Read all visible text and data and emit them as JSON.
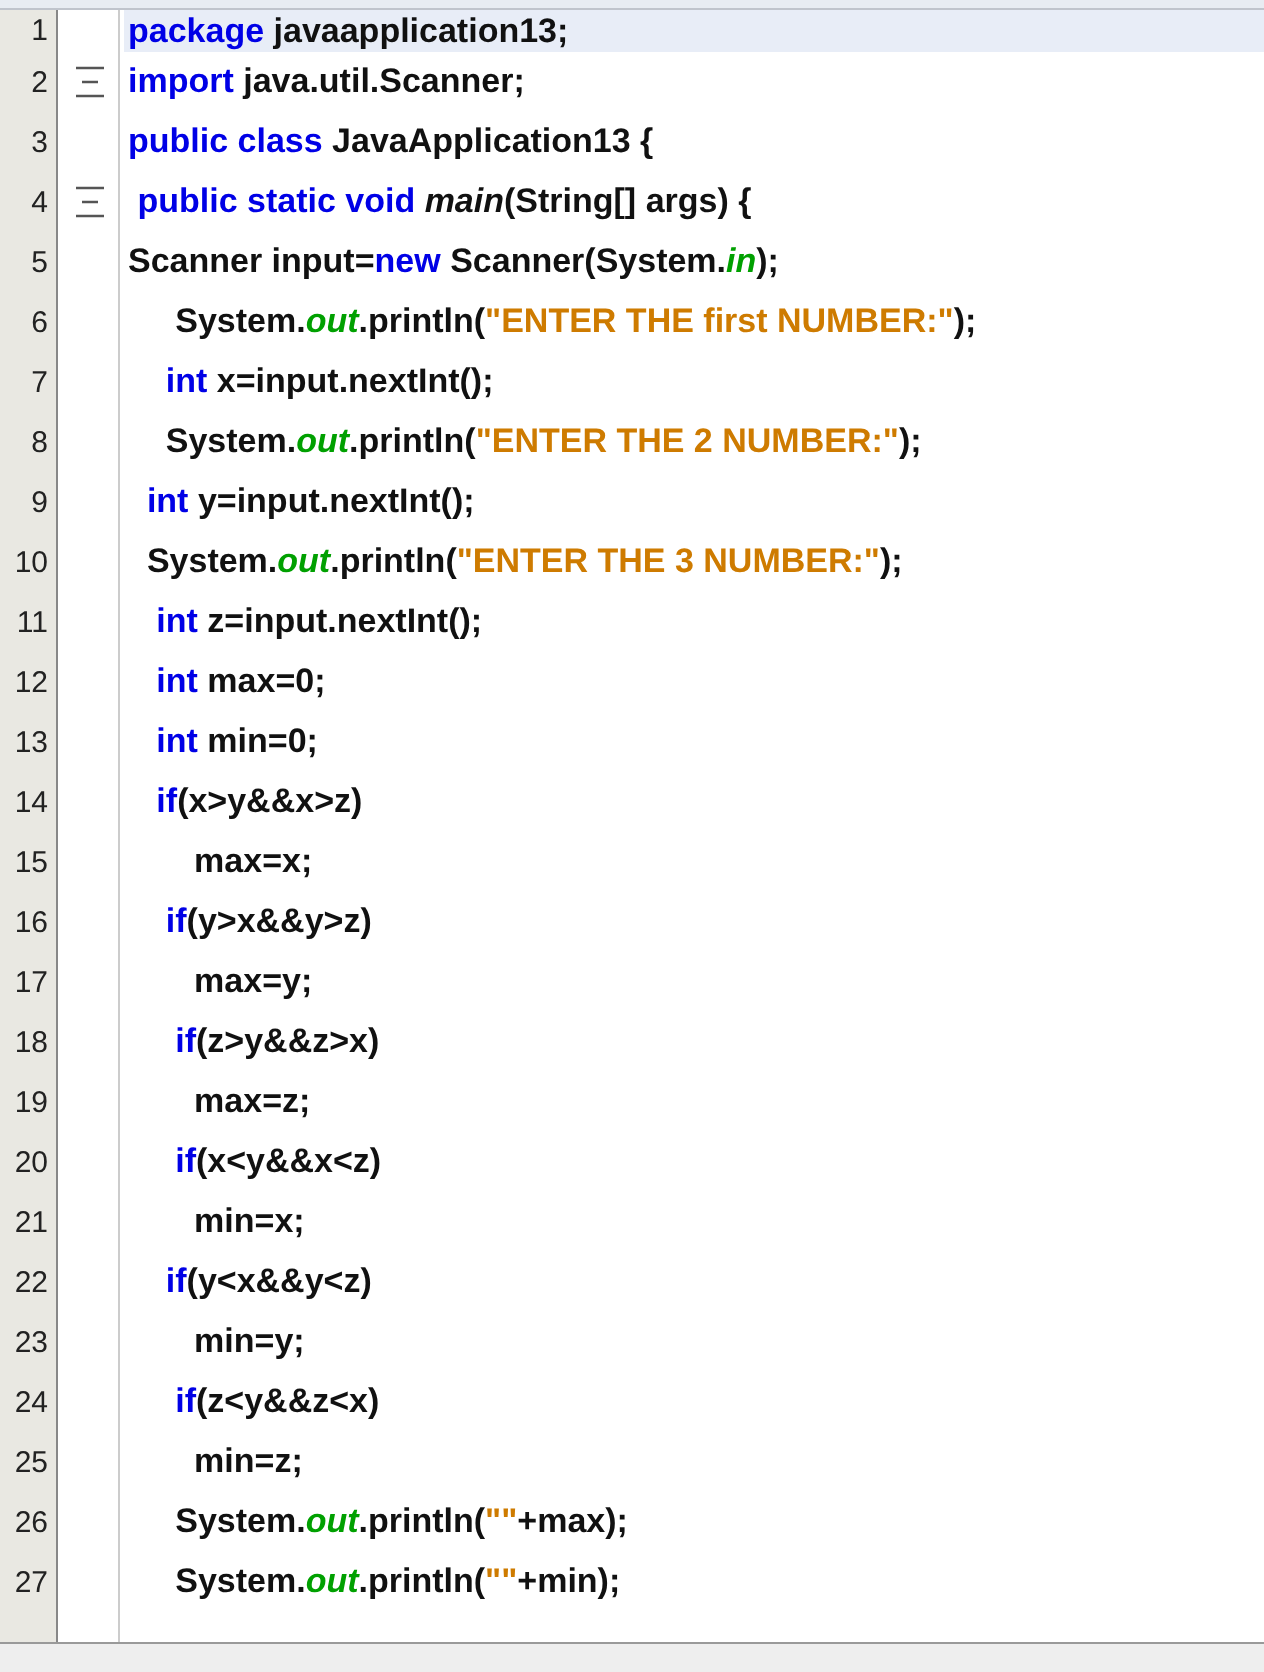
{
  "editor": {
    "lines": [
      {
        "number": "1",
        "current": true,
        "fold": false,
        "tokens": [
          {
            "kind": "kw",
            "text": "package"
          },
          {
            "kind": "txt",
            "text": " javaapplication13;"
          }
        ]
      },
      {
        "number": "2",
        "current": false,
        "fold": true,
        "tokens": [
          {
            "kind": "kw",
            "text": "import"
          },
          {
            "kind": "txt",
            "text": " java.util.Scanner;"
          }
        ]
      },
      {
        "number": "3",
        "current": false,
        "fold": false,
        "tokens": [
          {
            "kind": "kw",
            "text": "public class"
          },
          {
            "kind": "txt",
            "text": " JavaApplication13 {"
          }
        ]
      },
      {
        "number": "4",
        "current": false,
        "fold": true,
        "tokens": [
          {
            "kind": "kw",
            "text": " public static void "
          },
          {
            "kind": "method",
            "text": "main"
          },
          {
            "kind": "txt",
            "text": "(String[] args) {"
          }
        ]
      },
      {
        "number": "5",
        "current": false,
        "fold": false,
        "tokens": [
          {
            "kind": "txt",
            "text": "Scanner input="
          },
          {
            "kind": "kw",
            "text": "new"
          },
          {
            "kind": "txt",
            "text": " Scanner(System."
          },
          {
            "kind": "field",
            "text": "in"
          },
          {
            "kind": "txt",
            "text": ");"
          }
        ]
      },
      {
        "number": "6",
        "current": false,
        "fold": false,
        "tokens": [
          {
            "kind": "txt",
            "text": "     System."
          },
          {
            "kind": "field",
            "text": "out"
          },
          {
            "kind": "txt",
            "text": ".println("
          },
          {
            "kind": "str",
            "text": "\"ENTER THE first NUMBER:\""
          },
          {
            "kind": "txt",
            "text": ");"
          }
        ]
      },
      {
        "number": "7",
        "current": false,
        "fold": false,
        "tokens": [
          {
            "kind": "kw",
            "text": "    int"
          },
          {
            "kind": "txt",
            "text": " x=input.nextInt();"
          }
        ]
      },
      {
        "number": "8",
        "current": false,
        "fold": false,
        "tokens": [
          {
            "kind": "txt",
            "text": "    System."
          },
          {
            "kind": "field",
            "text": "out"
          },
          {
            "kind": "txt",
            "text": ".println("
          },
          {
            "kind": "str",
            "text": "\"ENTER THE 2 NUMBER:\""
          },
          {
            "kind": "txt",
            "text": ");"
          }
        ]
      },
      {
        "number": "9",
        "current": false,
        "fold": false,
        "tokens": [
          {
            "kind": "kw",
            "text": "  int"
          },
          {
            "kind": "txt",
            "text": " y=input.nextInt();"
          }
        ]
      },
      {
        "number": "10",
        "current": false,
        "fold": false,
        "tokens": [
          {
            "kind": "txt",
            "text": "  System."
          },
          {
            "kind": "field",
            "text": "out"
          },
          {
            "kind": "txt",
            "text": ".println("
          },
          {
            "kind": "str",
            "text": "\"ENTER THE 3 NUMBER:\""
          },
          {
            "kind": "txt",
            "text": ");"
          }
        ]
      },
      {
        "number": "11",
        "current": false,
        "fold": false,
        "tokens": [
          {
            "kind": "kw",
            "text": "   int"
          },
          {
            "kind": "txt",
            "text": " z=input.nextInt();"
          }
        ]
      },
      {
        "number": "12",
        "current": false,
        "fold": false,
        "tokens": [
          {
            "kind": "kw",
            "text": "   int"
          },
          {
            "kind": "txt",
            "text": " max=0;"
          }
        ]
      },
      {
        "number": "13",
        "current": false,
        "fold": false,
        "tokens": [
          {
            "kind": "kw",
            "text": "   int"
          },
          {
            "kind": "txt",
            "text": " min=0;"
          }
        ]
      },
      {
        "number": "14",
        "current": false,
        "fold": false,
        "tokens": [
          {
            "kind": "kw",
            "text": "   if"
          },
          {
            "kind": "txt",
            "text": "(x>y&&x>z)"
          }
        ]
      },
      {
        "number": "15",
        "current": false,
        "fold": false,
        "tokens": [
          {
            "kind": "txt",
            "text": "       max=x;"
          }
        ]
      },
      {
        "number": "16",
        "current": false,
        "fold": false,
        "tokens": [
          {
            "kind": "kw",
            "text": "    if"
          },
          {
            "kind": "txt",
            "text": "(y>x&&y>z)"
          }
        ]
      },
      {
        "number": "17",
        "current": false,
        "fold": false,
        "tokens": [
          {
            "kind": "txt",
            "text": "       max=y;"
          }
        ]
      },
      {
        "number": "18",
        "current": false,
        "fold": false,
        "tokens": [
          {
            "kind": "kw",
            "text": "     if"
          },
          {
            "kind": "txt",
            "text": "(z>y&&z>x)"
          }
        ]
      },
      {
        "number": "19",
        "current": false,
        "fold": false,
        "tokens": [
          {
            "kind": "txt",
            "text": "       max=z;"
          }
        ]
      },
      {
        "number": "20",
        "current": false,
        "fold": false,
        "tokens": [
          {
            "kind": "kw",
            "text": "     if"
          },
          {
            "kind": "txt",
            "text": "(x<y&&x<z)"
          }
        ]
      },
      {
        "number": "21",
        "current": false,
        "fold": false,
        "tokens": [
          {
            "kind": "txt",
            "text": "       min=x;"
          }
        ]
      },
      {
        "number": "22",
        "current": false,
        "fold": false,
        "tokens": [
          {
            "kind": "kw",
            "text": "    if"
          },
          {
            "kind": "txt",
            "text": "(y<x&&y<z)"
          }
        ]
      },
      {
        "number": "23",
        "current": false,
        "fold": false,
        "tokens": [
          {
            "kind": "txt",
            "text": "       min=y;"
          }
        ]
      },
      {
        "number": "24",
        "current": false,
        "fold": false,
        "tokens": [
          {
            "kind": "kw",
            "text": "     if"
          },
          {
            "kind": "txt",
            "text": "(z<y&&z<x)"
          }
        ]
      },
      {
        "number": "25",
        "current": false,
        "fold": false,
        "tokens": [
          {
            "kind": "txt",
            "text": "       min=z;"
          }
        ]
      },
      {
        "number": "26",
        "current": false,
        "fold": false,
        "tokens": [
          {
            "kind": "txt",
            "text": "     System."
          },
          {
            "kind": "field",
            "text": "out"
          },
          {
            "kind": "txt",
            "text": ".println("
          },
          {
            "kind": "str",
            "text": "\"\""
          },
          {
            "kind": "txt",
            "text": "+max);"
          }
        ]
      },
      {
        "number": "27",
        "current": false,
        "fold": false,
        "tokens": [
          {
            "kind": "txt",
            "text": "     System."
          },
          {
            "kind": "field",
            "text": "out"
          },
          {
            "kind": "txt",
            "text": ".println("
          },
          {
            "kind": "str",
            "text": "\"\""
          },
          {
            "kind": "txt",
            "text": "+min);"
          }
        ]
      }
    ]
  }
}
